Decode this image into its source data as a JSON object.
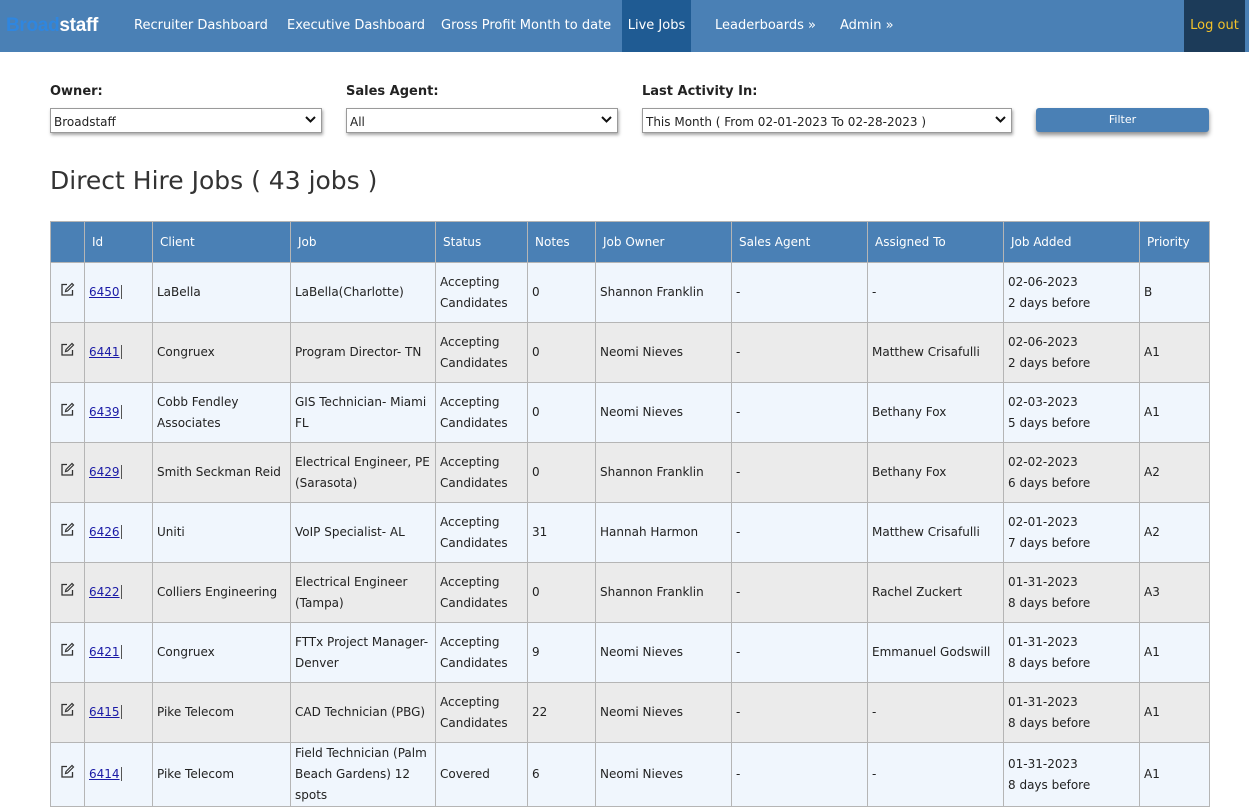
{
  "nav": {
    "logo_part1": "Broad",
    "logo_part2": "staff",
    "items": [
      "Recruiter Dashboard",
      "Executive Dashboard",
      "Gross Profit Month to date",
      "Live Jobs",
      "Leaderboards »",
      "Admin »"
    ],
    "logout": "Log out"
  },
  "filters": {
    "owner_label": "Owner:",
    "owner_value": "Broadstaff",
    "sales_label": "Sales Agent:",
    "sales_value": "All",
    "activity_label": "Last Activity In:",
    "activity_value": "This Month ( From 02-01-2023 To 02-28-2023 )",
    "filter_button": "Filter"
  },
  "page_title": "Direct Hire Jobs ( 43 jobs )",
  "table": {
    "headers": [
      "",
      "Id",
      "Client",
      "Job",
      "Status",
      "Notes",
      "Job Owner",
      "Sales Agent",
      "Assigned To",
      "Job Added",
      "Priority"
    ],
    "rows": [
      {
        "id": "6450",
        "client": "LaBella",
        "job": "LaBella(Charlotte)",
        "status": "Accepting Candidates",
        "notes": "0",
        "owner": "Shannon Franklin",
        "sales": "-",
        "assigned": "-",
        "added_date": "02-06-2023",
        "added_ago": "2 days before",
        "priority": "B"
      },
      {
        "id": "6441",
        "client": "Congruex",
        "job": "Program Director- TN",
        "status": "Accepting Candidates",
        "notes": "0",
        "owner": "Neomi Nieves",
        "sales": "-",
        "assigned": "Matthew Crisafulli",
        "added_date": "02-06-2023",
        "added_ago": "2 days before",
        "priority": "A1"
      },
      {
        "id": "6439",
        "client": "Cobb Fendley Associates",
        "job": "GIS Technician- Miami FL",
        "status": "Accepting Candidates",
        "notes": "0",
        "owner": "Neomi Nieves",
        "sales": "-",
        "assigned": "Bethany Fox",
        "added_date": "02-03-2023",
        "added_ago": "5 days before",
        "priority": "A1"
      },
      {
        "id": "6429",
        "client": "Smith Seckman Reid",
        "job": "Electrical Engineer, PE (Sarasota)",
        "status": "Accepting Candidates",
        "notes": "0",
        "owner": "Shannon Franklin",
        "sales": "-",
        "assigned": "Bethany Fox",
        "added_date": "02-02-2023",
        "added_ago": "6 days before",
        "priority": "A2"
      },
      {
        "id": "6426",
        "client": "Uniti",
        "job": "VoIP Specialist- AL",
        "status": "Accepting Candidates",
        "notes": "31",
        "owner": "Hannah Harmon",
        "sales": "-",
        "assigned": "Matthew Crisafulli",
        "added_date": "02-01-2023",
        "added_ago": "7 days before",
        "priority": "A2"
      },
      {
        "id": "6422",
        "client": "Colliers Engineering",
        "job": "Electrical Engineer (Tampa)",
        "status": "Accepting Candidates",
        "notes": "0",
        "owner": "Shannon Franklin",
        "sales": "-",
        "assigned": "Rachel Zuckert",
        "added_date": "01-31-2023",
        "added_ago": "8 days before",
        "priority": "A3"
      },
      {
        "id": "6421",
        "client": "Congruex",
        "job": "FTTx Project Manager- Denver",
        "status": "Accepting Candidates",
        "notes": "9",
        "owner": "Neomi Nieves",
        "sales": "-",
        "assigned": "Emmanuel Godswill",
        "added_date": "01-31-2023",
        "added_ago": "8 days before",
        "priority": "A1"
      },
      {
        "id": "6415",
        "client": "Pike Telecom",
        "job": "CAD Technician (PBG)",
        "status": "Accepting Candidates",
        "notes": "22",
        "owner": "Neomi Nieves",
        "sales": "-",
        "assigned": "-",
        "added_date": "01-31-2023",
        "added_ago": "8 days before",
        "priority": "A1"
      },
      {
        "id": "6414",
        "client": "Pike Telecom",
        "job": "Field Technician (Palm Beach Gardens) 12 spots",
        "status": "Covered",
        "notes": "6",
        "owner": "Neomi Nieves",
        "sales": "-",
        "assigned": "-",
        "added_date": "01-31-2023",
        "added_ago": "8 days before",
        "priority": "A1"
      }
    ]
  }
}
